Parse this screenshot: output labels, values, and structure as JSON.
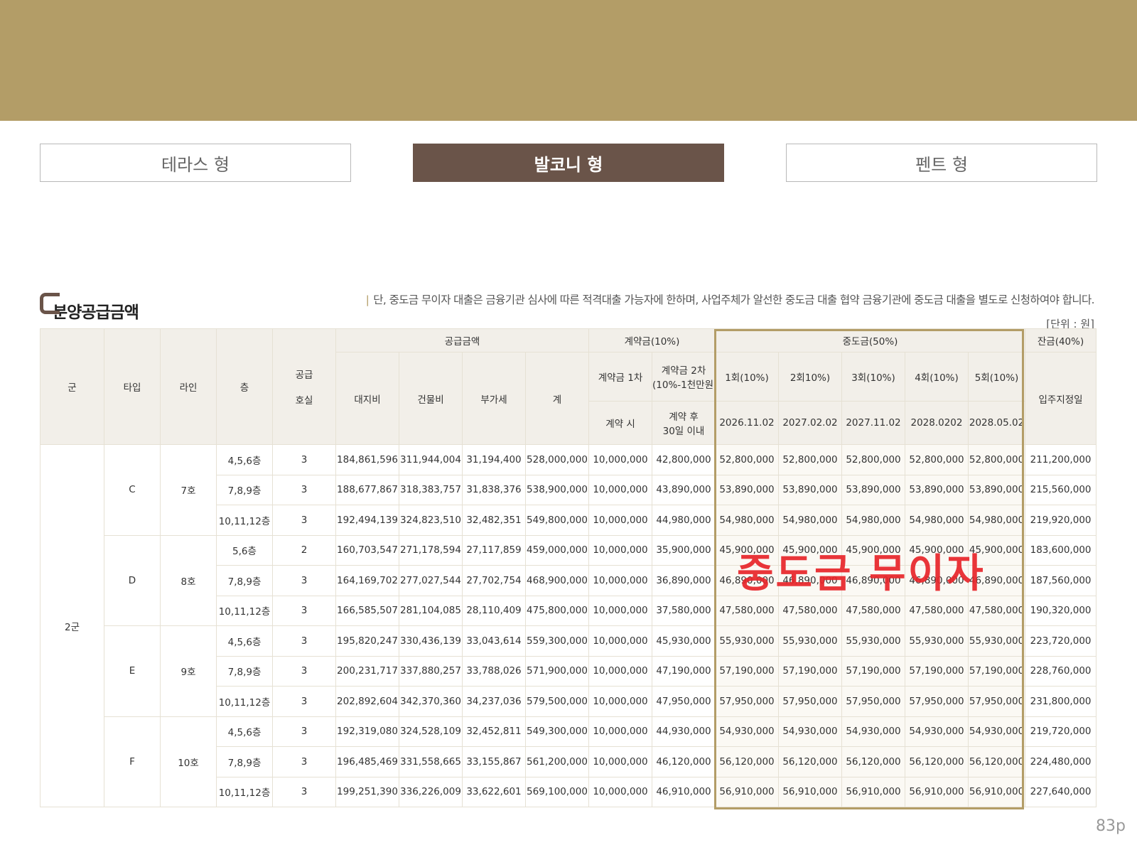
{
  "tabs": [
    "테라스 형",
    "발코니 형",
    "펜트 형"
  ],
  "active_tab_index": 1,
  "section": {
    "title": "분양공급금액",
    "notice_bar": "|",
    "notice": "단, 중도금 무이자 대출은 금융기관 심사에 따른 적격대출 가능자에 한하며, 사업주체가 알선한 중도금 대출 협약 금융기관에 중도금 대출을 별도로 신청하여야 합니다.",
    "unit": "[단위 : 원]"
  },
  "table": {
    "head": {
      "group": "군",
      "type": "타입",
      "line": "라인",
      "floor": "층",
      "supply_units_1": "공급",
      "supply_units_2": "호실",
      "supply_price": "공급금액",
      "land": "대지비",
      "building": "건물비",
      "vat": "부가세",
      "total": "계",
      "contract": "계약금(10%)",
      "contract1": "계약금 1차",
      "contract1_when": "계약 시",
      "contract2_l1": "계약금 2차",
      "contract2_l2": "(10%-1천만원)",
      "contract2_when_l1": "계약 후",
      "contract2_when_l2": "30일 이내",
      "middle": "중도금(50%)",
      "middle_rounds": [
        "1회(10%)",
        "2회10%)",
        "3회(10%)",
        "4회(10%)",
        "5회(10%)"
      ],
      "middle_dates": [
        "2026.11.02",
        "2027.02.02",
        "2027.11.02",
        "2028.0202",
        "2028.05.02"
      ],
      "balance": "잔금(40%)",
      "balance_when": "입주지정일"
    },
    "group_name": "2군",
    "blocks": [
      {
        "type": "C",
        "line": "7호",
        "rows": [
          [
            "4,5,6층",
            "3",
            "184,861,596",
            "311,944,004",
            "31,194,400",
            "528,000,000",
            "10,000,000",
            "42,800,000",
            "52,800,000",
            "52,800,000",
            "52,800,000",
            "52,800,000",
            "52,800,000",
            "211,200,000"
          ],
          [
            "7,8,9층",
            "3",
            "188,677,867",
            "318,383,757",
            "31,838,376",
            "538,900,000",
            "10,000,000",
            "43,890,000",
            "53,890,000",
            "53,890,000",
            "53,890,000",
            "53,890,000",
            "53,890,000",
            "215,560,000"
          ],
          [
            "10,11,12층",
            "3",
            "192,494,139",
            "324,823,510",
            "32,482,351",
            "549,800,000",
            "10,000,000",
            "44,980,000",
            "54,980,000",
            "54,980,000",
            "54,980,000",
            "54,980,000",
            "54,980,000",
            "219,920,000"
          ]
        ]
      },
      {
        "type": "D",
        "line": "8호",
        "rows": [
          [
            "5,6층",
            "2",
            "160,703,547",
            "271,178,594",
            "27,117,859",
            "459,000,000",
            "10,000,000",
            "35,900,000",
            "45,900,000",
            "45,900,000",
            "45,900,000",
            "45,900,000",
            "45,900,000",
            "183,600,000"
          ],
          [
            "7,8,9층",
            "3",
            "164,169,702",
            "277,027,544",
            "27,702,754",
            "468,900,000",
            "10,000,000",
            "36,890,000",
            "46,890,000",
            "46,890,000",
            "46,890,000",
            "46,890,000",
            "46,890,000",
            "187,560,000"
          ],
          [
            "10,11,12층",
            "3",
            "166,585,507",
            "281,104,085",
            "28,110,409",
            "475,800,000",
            "10,000,000",
            "37,580,000",
            "47,580,000",
            "47,580,000",
            "47,580,000",
            "47,580,000",
            "47,580,000",
            "190,320,000"
          ]
        ]
      },
      {
        "type": "E",
        "line": "9호",
        "rows": [
          [
            "4,5,6층",
            "3",
            "195,820,247",
            "330,436,139",
            "33,043,614",
            "559,300,000",
            "10,000,000",
            "45,930,000",
            "55,930,000",
            "55,930,000",
            "55,930,000",
            "55,930,000",
            "55,930,000",
            "223,720,000"
          ],
          [
            "7,8,9층",
            "3",
            "200,231,717",
            "337,880,257",
            "33,788,026",
            "571,900,000",
            "10,000,000",
            "47,190,000",
            "57,190,000",
            "57,190,000",
            "57,190,000",
            "57,190,000",
            "57,190,000",
            "228,760,000"
          ],
          [
            "10,11,12층",
            "3",
            "202,892,604",
            "342,370,360",
            "34,237,036",
            "579,500,000",
            "10,000,000",
            "47,950,000",
            "57,950,000",
            "57,950,000",
            "57,950,000",
            "57,950,000",
            "57,950,000",
            "231,800,000"
          ]
        ]
      },
      {
        "type": "F",
        "line": "10호",
        "rows": [
          [
            "4,5,6층",
            "3",
            "192,319,080",
            "324,528,109",
            "32,452,811",
            "549,300,000",
            "10,000,000",
            "44,930,000",
            "54,930,000",
            "54,930,000",
            "54,930,000",
            "54,930,000",
            "54,930,000",
            "219,720,000"
          ],
          [
            "7,8,9층",
            "3",
            "196,485,469",
            "331,558,665",
            "33,155,867",
            "561,200,000",
            "10,000,000",
            "46,120,000",
            "56,120,000",
            "56,120,000",
            "56,120,000",
            "56,120,000",
            "56,120,000",
            "224,480,000"
          ],
          [
            "10,11,12층",
            "3",
            "199,251,390",
            "336,226,009",
            "33,622,601",
            "569,100,000",
            "10,000,000",
            "46,910,000",
            "56,910,000",
            "56,910,000",
            "56,910,000",
            "56,910,000",
            "56,910,000",
            "227,640,000"
          ]
        ]
      }
    ]
  },
  "overlay_text": "중도금 무이자",
  "page_number": "83p",
  "colors": {
    "banner": "#b39d67",
    "active_tab": "#6a5449",
    "overlay": "#e8252a"
  }
}
